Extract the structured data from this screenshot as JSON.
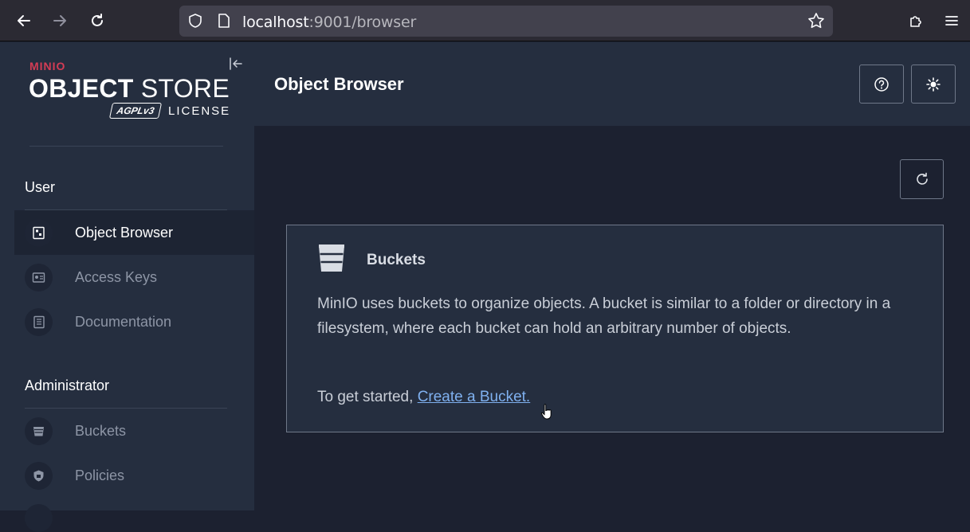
{
  "browser": {
    "url_host": "localhost",
    "url_rest": ":9001/browser"
  },
  "sidebar": {
    "brand_mini": "MINIO",
    "brand_object": "OBJECT",
    "brand_store": "STORE",
    "brand_agpl": "AGPLv3",
    "brand_license": "LICENSE",
    "sections": [
      {
        "title": "User",
        "items": [
          {
            "label": "Object Browser",
            "icon": "object-browser-icon",
            "active": true
          },
          {
            "label": "Access Keys",
            "icon": "access-keys-icon",
            "active": false
          },
          {
            "label": "Documentation",
            "icon": "documentation-icon",
            "active": false
          }
        ]
      },
      {
        "title": "Administrator",
        "items": [
          {
            "label": "Buckets",
            "icon": "bucket-icon",
            "active": false
          },
          {
            "label": "Policies",
            "icon": "lock-icon",
            "active": false
          }
        ]
      }
    ]
  },
  "header": {
    "title": "Object Browser"
  },
  "card": {
    "title": "Buckets",
    "body": "MinIO uses buckets to organize objects. A bucket is similar to a folder or directory in a filesystem, where each bucket can hold an arbitrary number of objects.",
    "cta_prefix": "To get started,",
    "cta_link": "Create a Bucket."
  },
  "colors": {
    "brand_red": "#d43c55",
    "link": "#7fb0ef",
    "sidebar_bg": "#252e3f",
    "main_bg": "#1c2130"
  }
}
